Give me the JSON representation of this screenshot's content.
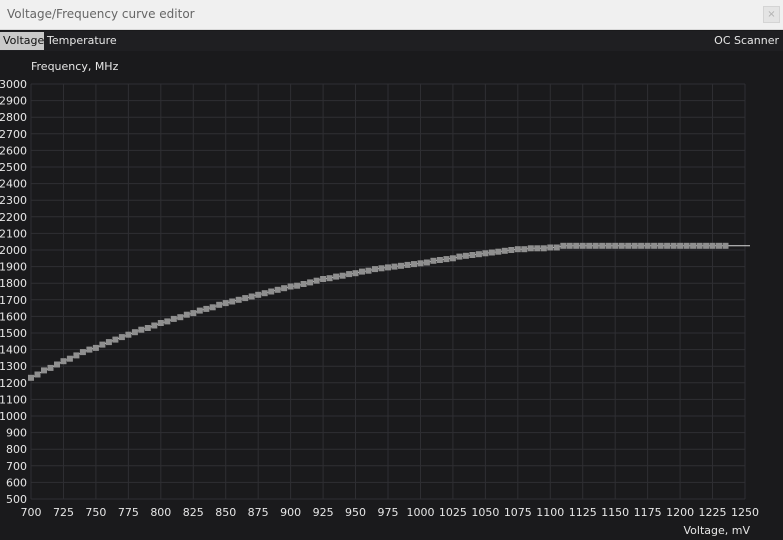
{
  "window": {
    "title": "Voltage/Frequency curve editor",
    "close_glyph": "×"
  },
  "tabs": [
    {
      "label": "Voltage",
      "active": true
    },
    {
      "label": "Temperature",
      "active": false
    }
  ],
  "oc_scanner_label": "OC Scanner",
  "colors": {
    "background": "#1a1a1c",
    "grid": "#2f2f33",
    "curve": "#d8d8d8",
    "points": "#8f8f8f",
    "text": "#e6e6e6"
  },
  "chart_data": {
    "type": "line",
    "ylabel": "Frequency, MHz",
    "xlabel": "Voltage, mV",
    "xlim": [
      700,
      1250
    ],
    "ylim": [
      500,
      3000
    ],
    "x_ticks": [
      700,
      725,
      750,
      775,
      800,
      825,
      850,
      875,
      900,
      925,
      950,
      975,
      1000,
      1025,
      1050,
      1075,
      1100,
      1125,
      1150,
      1175,
      1200,
      1225,
      1250
    ],
    "y_ticks": [
      500,
      600,
      700,
      800,
      900,
      1000,
      1100,
      1200,
      1300,
      1400,
      1500,
      1600,
      1700,
      1800,
      1900,
      2000,
      2100,
      2200,
      2300,
      2400,
      2500,
      2600,
      2700,
      2800,
      2900,
      3000
    ],
    "grid": true,
    "series": [
      {
        "x": [
          700,
          705,
          710,
          715,
          720,
          725,
          730,
          735,
          740,
          745,
          750,
          755,
          760,
          765,
          770,
          775,
          780,
          785,
          790,
          795,
          800,
          805,
          810,
          815,
          820,
          825,
          830,
          835,
          840,
          845,
          850,
          855,
          860,
          865,
          870,
          875,
          880,
          885,
          890,
          895,
          900,
          905,
          910,
          915,
          920,
          925,
          930,
          935,
          940,
          945,
          950,
          955,
          960,
          965,
          970,
          975,
          980,
          985,
          990,
          995,
          1000,
          1005,
          1010,
          1015,
          1020,
          1025,
          1030,
          1035,
          1040,
          1045,
          1050,
          1055,
          1060,
          1065,
          1070,
          1075,
          1080,
          1085,
          1090,
          1095,
          1100,
          1105,
          1110,
          1115,
          1120,
          1125,
          1130,
          1135,
          1140,
          1145,
          1150,
          1155,
          1160,
          1165,
          1170,
          1175,
          1180,
          1185,
          1190,
          1195,
          1200,
          1205,
          1210,
          1215,
          1220,
          1225,
          1230,
          1235
        ],
        "values": [
          1230,
          1250,
          1275,
          1290,
          1310,
          1330,
          1345,
          1365,
          1385,
          1400,
          1410,
          1430,
          1445,
          1460,
          1475,
          1490,
          1505,
          1520,
          1530,
          1545,
          1560,
          1570,
          1585,
          1595,
          1610,
          1620,
          1635,
          1645,
          1655,
          1670,
          1680,
          1690,
          1700,
          1710,
          1720,
          1730,
          1740,
          1750,
          1760,
          1770,
          1780,
          1785,
          1795,
          1805,
          1815,
          1825,
          1830,
          1840,
          1845,
          1855,
          1860,
          1870,
          1875,
          1885,
          1890,
          1895,
          1900,
          1905,
          1910,
          1915,
          1920,
          1925,
          1935,
          1940,
          1945,
          1950,
          1960,
          1965,
          1970,
          1975,
          1980,
          1985,
          1990,
          1995,
          2000,
          2005,
          2005,
          2010,
          2010,
          2010,
          2015,
          2015,
          2025,
          2025,
          2025,
          2025,
          2025,
          2025,
          2025,
          2025,
          2025,
          2025,
          2025,
          2025,
          2025,
          2025,
          2025,
          2025,
          2025,
          2025,
          2025,
          2025,
          2025,
          2025,
          2025,
          2025,
          2025,
          2025
        ]
      }
    ]
  }
}
